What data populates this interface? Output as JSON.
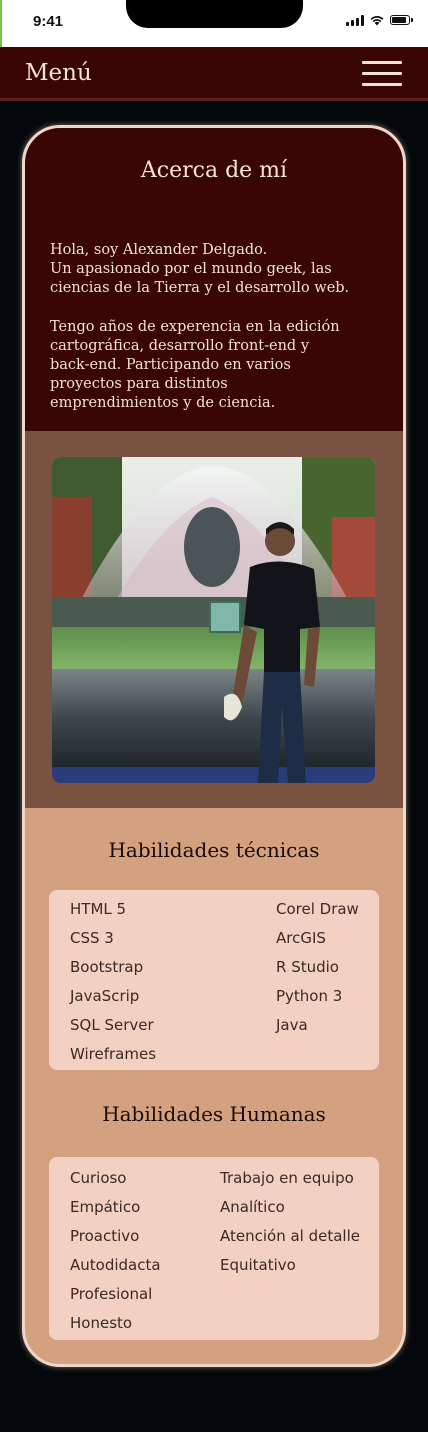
{
  "status_bar": {
    "time": "9:41"
  },
  "nav": {
    "title": "Menú"
  },
  "about": {
    "title": "Acerca de mí",
    "lines_1": [
      "Hola, soy Alexander Delgado.",
      "Un apasionado por el mundo geek, las",
      "ciencias de la Tierra y el desarrollo web."
    ],
    "lines_2": [
      "Tengo años de experencia en la edición",
      "cartográfica, desarrollo front-end y",
      "back-end. Participando en varios",
      "proyectos para distintos",
      "emprendimientos y de ciencia."
    ]
  },
  "technical": {
    "title": "Habilidades técnicas",
    "left": [
      "HTML 5",
      "CSS 3",
      "Bootstrap",
      "JavaScrip",
      "SQL Server",
      "Wireframes"
    ],
    "right": [
      "Corel Draw",
      "ArcGIS",
      "R Studio",
      "Python 3",
      "Java"
    ]
  },
  "human": {
    "title": "Habilidades Humanas",
    "left": [
      "Curioso",
      "Empático",
      "Proactivo",
      "Autodidacta",
      "Profesional",
      "Honesto"
    ],
    "right": [
      "Trabajo en equipo",
      "Analítico",
      "Atención al detalle",
      "Equitativo"
    ]
  },
  "colors": {
    "nav_bg": "#3a0505",
    "about_bg": "#3a0505",
    "photo_band": "#7a5242",
    "skills_bg": "#d3a17f",
    "list_box": "#f2d0c2",
    "page_bg": "#05080b"
  }
}
